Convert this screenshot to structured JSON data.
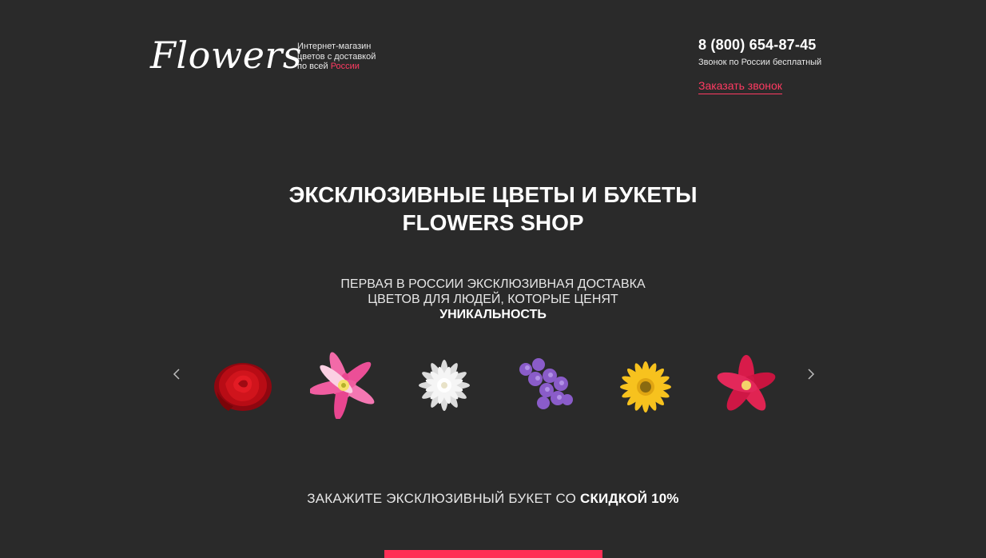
{
  "header": {
    "logo": "Flowers",
    "tagline": {
      "line1": "Интернет-магазин",
      "line2": "цветов с доставкой",
      "line3_prefix": "по всей",
      "line3_accent": "России"
    },
    "phone": "8 (800) 654-87-45",
    "phone_note": "Звонок по России бесплатный",
    "callback_label": "Заказать звонок"
  },
  "hero": {
    "title_line1": "ЭКСКЛЮЗИВНЫЕ ЦВЕТЫ И БУКЕТЫ",
    "title_line2": "FLOWERS SHOP",
    "subtitle_line1": "ПЕРВАЯ В РОССИИ ЭКСКЛЮЗИВНАЯ ДОСТАВКА",
    "subtitle_line2_prefix": "ЦВЕТОВ ДЛЯ ЛЮДЕЙ, КОТОРЫЕ ЦЕНЯТ",
    "subtitle_line2_bold": "УНИКАЛЬНОСТЬ"
  },
  "carousel": {
    "prev_icon": "chevron-left-icon",
    "next_icon": "chevron-right-icon",
    "flowers": [
      {
        "name": "red-rose",
        "color": "#c8101c"
      },
      {
        "name": "pink-lily",
        "color": "#f0509a"
      },
      {
        "name": "white-dahlia",
        "color": "#f2f2f2"
      },
      {
        "name": "purple-lilac",
        "color": "#9b6fd6"
      },
      {
        "name": "yellow-gerbera",
        "color": "#f7c21e"
      },
      {
        "name": "red-alstroemeria",
        "color": "#d81b4a"
      }
    ]
  },
  "offer": {
    "prefix": "ЗАКАЖИТЕ ЭКСКЛЮЗИВНЫЙ БУКЕТ СО",
    "bold": "СКИДКОЙ 10%"
  },
  "colors": {
    "background": "#2a2a2a",
    "accent": "#ff3b62",
    "button": "#ff2d55"
  }
}
